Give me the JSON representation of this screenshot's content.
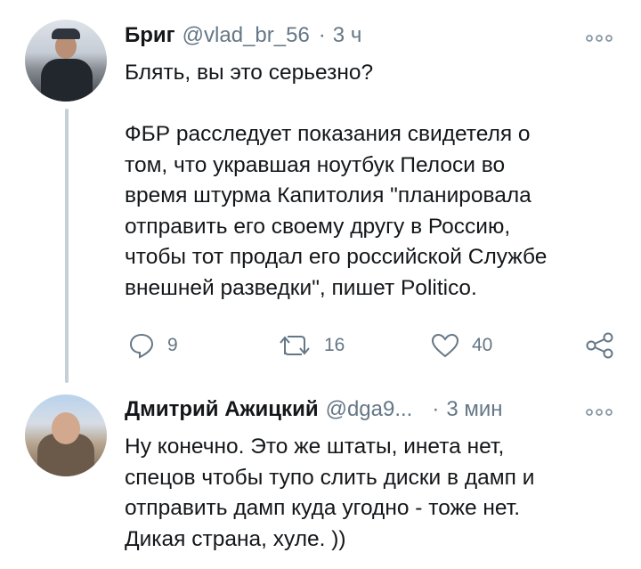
{
  "tweet1": {
    "name": "Бриг",
    "handle": "@vlad_br_56",
    "separator": "·",
    "time": "3 ч",
    "more_icon": "more-icon",
    "line1": "Блять, вы это серьезно?",
    "body": [
      "ФБР расследует показания свидетеля о",
      "том, что укравшая ноутбук Пелоси во",
      "время штурма Капитолия \"планировала",
      "отправить его своему другу в Россию,",
      "чтобы тот продал его российской Службе",
      "внешней разведки\", пишет Politico."
    ],
    "actions": {
      "reply_count": "9",
      "retweet_count": "16",
      "like_count": "40"
    }
  },
  "tweet2": {
    "name": "Дмитрий Ажицкий",
    "handle": "@dga9...",
    "separator": "·",
    "time": "3 мин",
    "lines": [
      "Ну конечно. Это же штаты, инета нет,",
      "спецов чтобы тупо слить диски в дамп и",
      "отправить дамп куда угодно - тоже нет.",
      "Дикая страна, хуле. ))"
    ]
  },
  "colors": {
    "text": "#14171a",
    "secondary": "#657786",
    "thread_line": "#c4cfd6"
  }
}
